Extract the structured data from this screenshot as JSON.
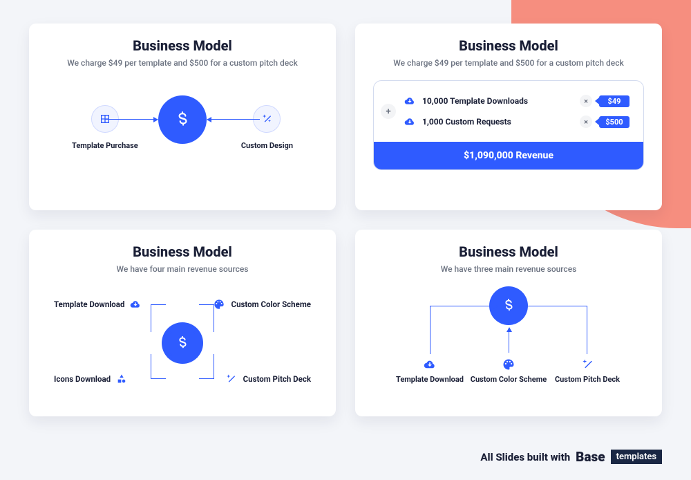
{
  "slide1": {
    "title": "Business Model",
    "subtitle": "We charge $49 per template and $500 for a custom pitch deck",
    "left_label": "Template Purchase",
    "right_label": "Custom Design"
  },
  "slide2": {
    "title": "Business Model",
    "subtitle": "We charge $49 per template and $500 for a custom pitch deck",
    "row1_name": "10,000 Template Downloads",
    "row1_price": "$49",
    "row2_name": "1,000 Custom Requests",
    "row2_price": "$500",
    "total": "$1,090,000 Revenue",
    "plus": "+",
    "times": "×"
  },
  "slide3": {
    "title": "Business Model",
    "subtitle": "We have four main revenue sources",
    "tl": "Template Download",
    "tr": "Custom Color Scheme",
    "bl": "Icons Download",
    "br": "Custom Pitch Deck"
  },
  "slide4": {
    "title": "Business Model",
    "subtitle": "We have three main revenue sources",
    "s1": "Template Download",
    "s2": "Custom Color Scheme",
    "s3": "Custom Pitch Deck"
  },
  "footer": {
    "text": "All Slides built with",
    "brand": "Base",
    "chip": "templates"
  },
  "colors": {
    "primary": "#2f5bff",
    "coral": "#f68e7f"
  }
}
